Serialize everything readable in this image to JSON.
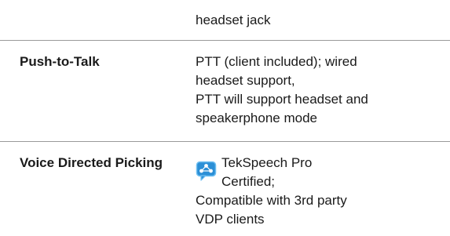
{
  "rows": [
    {
      "label": "",
      "value_lines": [
        "headset jack"
      ]
    },
    {
      "label": "Push-to-Talk",
      "value_lines": [
        "PTT (client included); wired",
        "headset support,",
        "PTT will support headset and",
        "speakerphone mode"
      ]
    },
    {
      "label": "Voice Directed Picking",
      "icon": "speech-bubble-network-icon",
      "value_head_lines": [
        "TekSpeech Pro",
        "Certified;"
      ],
      "value_lines": [
        "Compatible with 3rd party",
        "VDP clients"
      ]
    }
  ],
  "colors": {
    "divider": "#9a9a9a",
    "icon_blue": "#2b8fd6",
    "text": "#1a1a1a"
  }
}
